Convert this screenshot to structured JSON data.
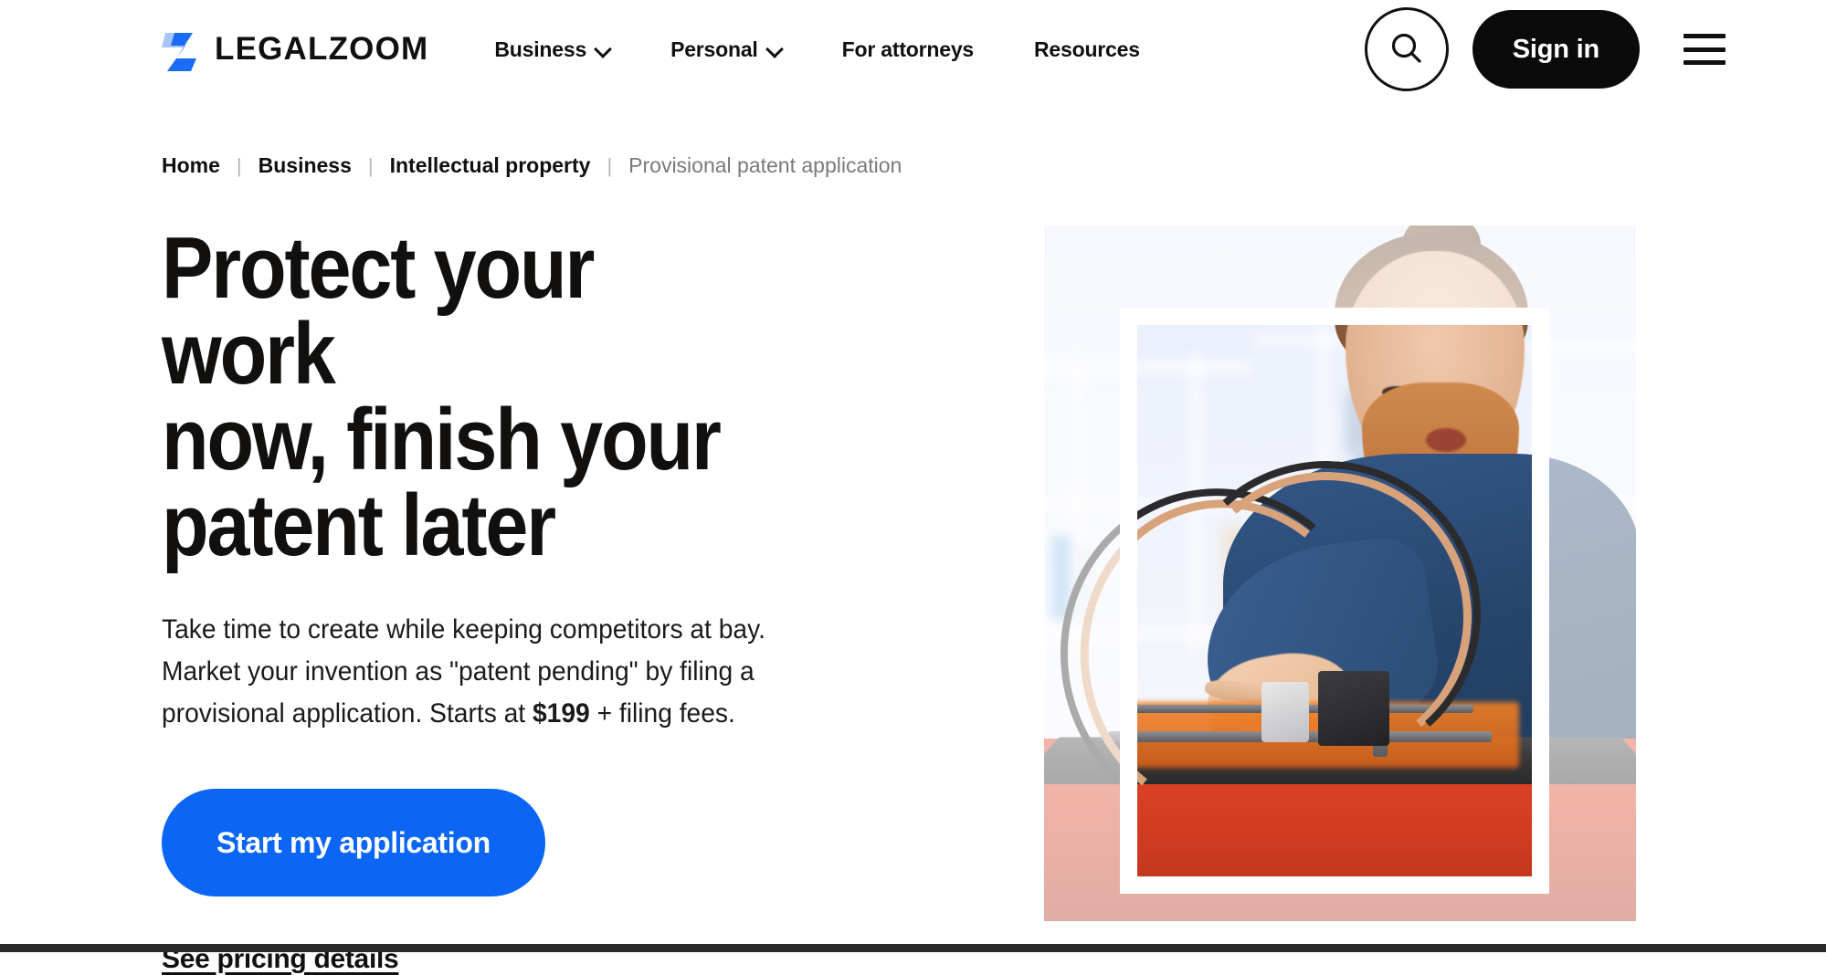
{
  "header": {
    "logo_text": "LEGALZOOM",
    "logo_icon": "legalzoom-z-mark",
    "nav": [
      {
        "label": "Business",
        "has_dropdown": true
      },
      {
        "label": "Personal",
        "has_dropdown": true
      },
      {
        "label": "For attorneys",
        "has_dropdown": false
      },
      {
        "label": "Resources",
        "has_dropdown": false
      }
    ],
    "search_icon": "search-icon",
    "signin_label": "Sign in",
    "menu_icon": "hamburger-menu-icon"
  },
  "breadcrumb": {
    "separator": "|",
    "items": [
      {
        "label": "Home",
        "current": false
      },
      {
        "label": "Business",
        "current": false
      },
      {
        "label": "Intellectual property",
        "current": false
      },
      {
        "label": "Provisional patent application",
        "current": true
      }
    ]
  },
  "hero": {
    "title": "Protect your work\nnow, finish your\npatent later",
    "subtitle_part1": "Take time to create while keeping competitors at bay. Market your invention as \"patent pending\" by filing a provisional application. Starts at ",
    "subtitle_price": "$199",
    "subtitle_part2": " + filing fees.",
    "cta_label": "Start my application",
    "pricing_link_label": "See pricing details",
    "image_alt": "Bearded man with man bun in navy shirt operating a red 3D printer in a bright office"
  },
  "colors": {
    "accent_blue": "#0b66f5",
    "logo_blue": "#1a6cf5",
    "logo_blue_light": "#a8c5fb",
    "text_dark": "#12100e",
    "text_muted": "#7a7a7a",
    "signin_bg": "#0b0b0b",
    "printer_red": "#d8441f",
    "shirt_navy": "#27466d"
  }
}
